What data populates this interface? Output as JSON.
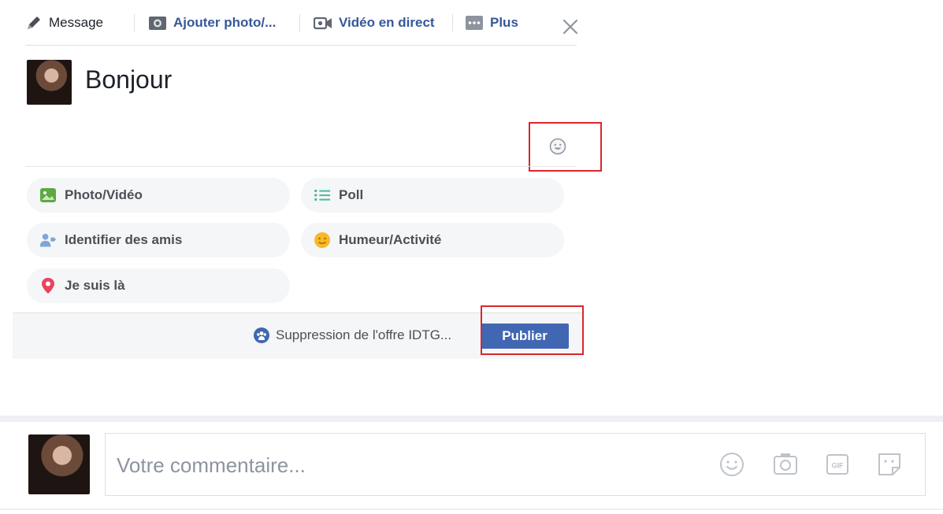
{
  "tabs": [
    {
      "label": "Message",
      "icon": "pencil-icon"
    },
    {
      "label": "Ajouter photo/...",
      "icon": "camera-icon"
    },
    {
      "label": "Vidéo en direct",
      "icon": "video-camera-icon"
    },
    {
      "label": "Plus",
      "icon": "more-icon"
    }
  ],
  "composer": {
    "text": "Bonjour",
    "options": [
      {
        "label": "Photo/Vidéo",
        "icon": "photo-icon",
        "color": "#5fa843"
      },
      {
        "label": "Poll",
        "icon": "list-icon",
        "color": "#4ab8a1"
      },
      {
        "label": "Identifier des amis",
        "icon": "tag-friends-icon",
        "color": "#7ea7d8"
      },
      {
        "label": "Humeur/Activité",
        "icon": "smiley-icon",
        "color": "#f7b928"
      },
      {
        "label": "Je suis là",
        "icon": "location-pin-icon",
        "color": "#e9445f"
      }
    ]
  },
  "footer": {
    "audience": "Suppression de l'offre IDTG...",
    "publish": "Publier"
  },
  "comment": {
    "placeholder": "Votre commentaire...",
    "icons": [
      "smiley-icon",
      "camera-icon",
      "gif-icon",
      "sticker-icon"
    ]
  },
  "colors": {
    "accent": "#4267b2",
    "highlight": "#d9262c"
  }
}
